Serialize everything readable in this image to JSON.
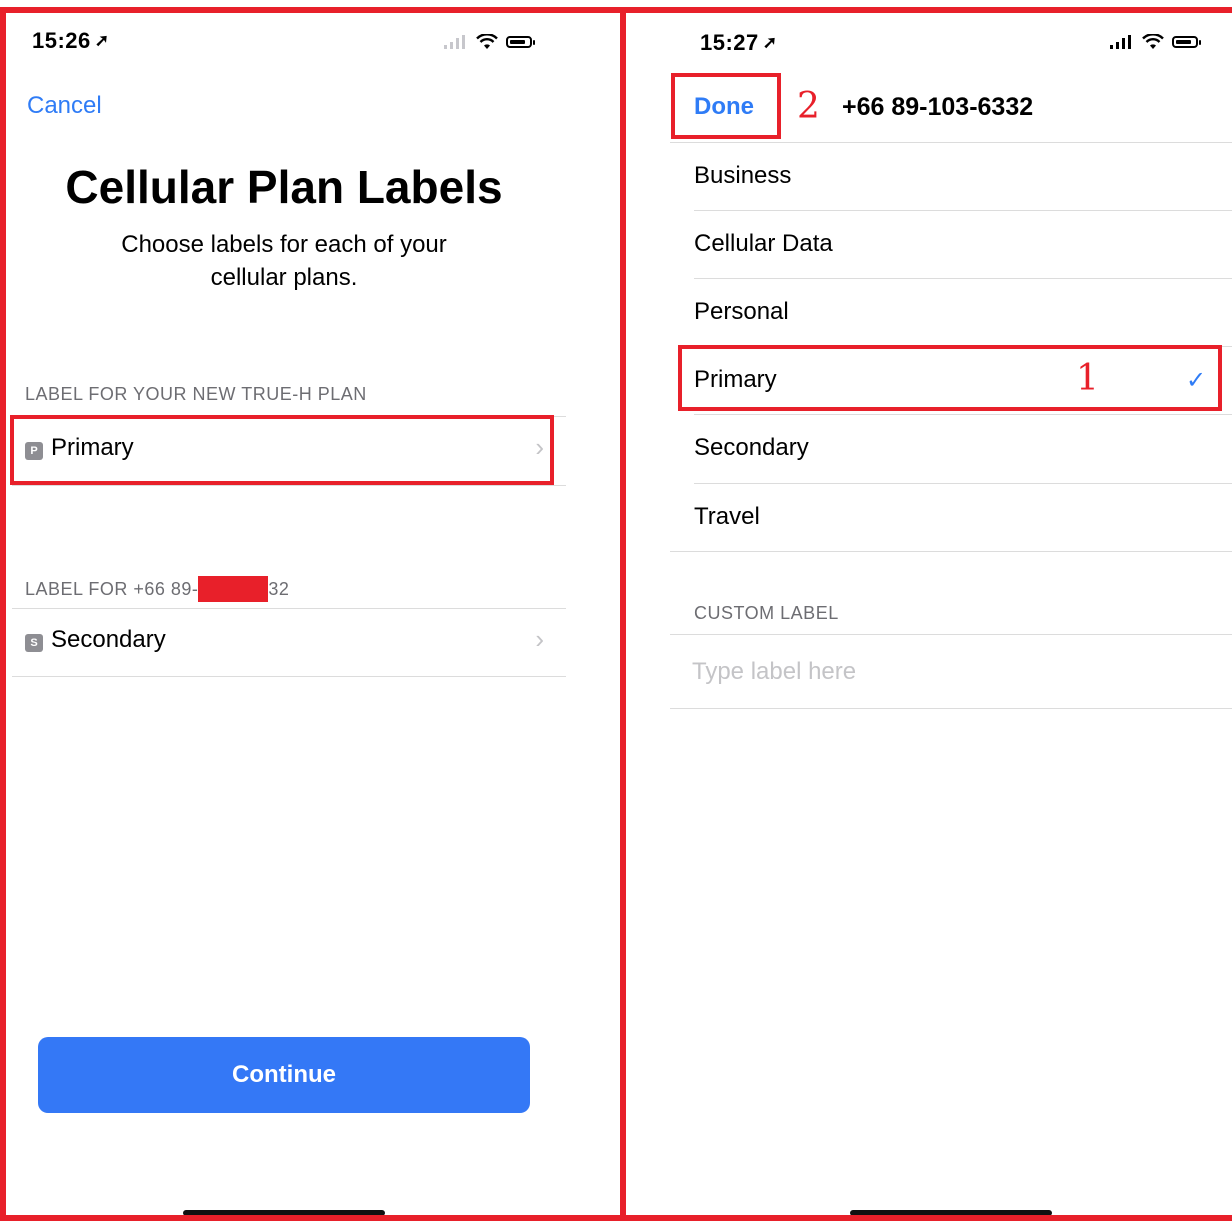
{
  "left_screen": {
    "status_time": "15:26",
    "location_arrow": "➚",
    "cancel": "Cancel",
    "title": "Cellular Plan Labels",
    "subtitle_line1": "Choose labels for each of your",
    "subtitle_line2": "cellular plans.",
    "section1_header": "LABEL FOR YOUR NEW TRUE-H PLAN",
    "row1": {
      "badge": "P",
      "label": "Primary",
      "chevron": "›"
    },
    "section2_header_prefix": "LABEL FOR +66 89-",
    "section2_header_suffix": "32",
    "row2": {
      "badge": "S",
      "label": "Secondary",
      "chevron": "›"
    },
    "continue_button": "Continue"
  },
  "right_screen": {
    "status_time": "15:27",
    "location_arrow": "➚",
    "done": "Done",
    "phone_number": "+66 89-103-6332",
    "labels": [
      "Business",
      "Cellular Data",
      "Personal",
      "Primary",
      "Secondary",
      "Travel"
    ],
    "selected_label": "Primary",
    "checkmark": "✓",
    "custom_label_header": "CUSTOM LABEL",
    "custom_label_placeholder": "Type label here"
  },
  "annotations": {
    "marker1": "1",
    "marker2": "2",
    "highlight_color": "#e8202a"
  },
  "colors": {
    "accent": "#2f7cf6",
    "button_bg": "#3478f6"
  },
  "icons": {
    "signal": "signal-icon",
    "wifi": "wifi-icon",
    "battery": "battery-icon",
    "location": "location-arrow-icon",
    "chevron": "chevron-right-icon",
    "checkmark": "checkmark-icon"
  }
}
